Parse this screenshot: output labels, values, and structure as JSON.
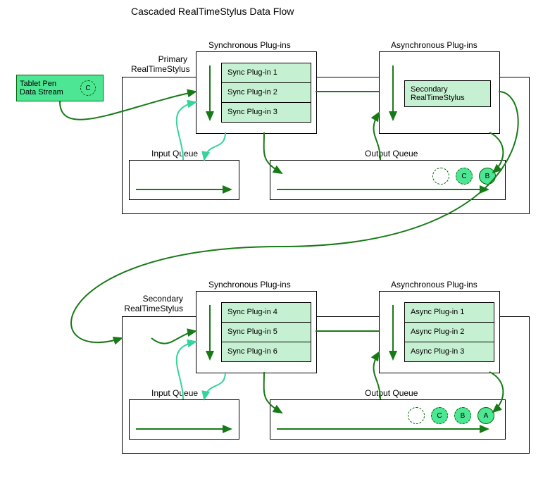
{
  "title": "Cascaded RealTimeStylus Data Flow",
  "tablet_pen": {
    "label": "Tablet Pen\nData Stream",
    "token": "C"
  },
  "primary": {
    "label": "Primary\nRealTimeStylus",
    "sync": {
      "heading": "Synchronous Plug-ins",
      "items": [
        "Sync Plug-in 1",
        "Sync Plug-in 2",
        "Sync Plug-in 3"
      ]
    },
    "async": {
      "heading": "Asynchronous Plug-ins",
      "secondary_label": "Secondary\nRealTimeStylus"
    },
    "input_queue": {
      "label": "Input Queue"
    },
    "output_queue": {
      "label": "Output Queue",
      "tokens": [
        {
          "letter": "",
          "style": "dashed"
        },
        {
          "letter": "C",
          "style": "dashed-fill"
        },
        {
          "letter": "B",
          "style": "solid-fill"
        }
      ]
    }
  },
  "secondary": {
    "label": "Secondary\nRealTimeStylus",
    "sync": {
      "heading": "Synchronous Plug-ins",
      "items": [
        "Sync Plug-in 4",
        "Sync Plug-in 5",
        "Sync Plug-in 6"
      ]
    },
    "async": {
      "heading": "Asynchronous Plug-ins",
      "items": [
        "Async Plug-in 1",
        "Async Plug-in 2",
        "Async Plug-in 3"
      ]
    },
    "input_queue": {
      "label": "Input Queue"
    },
    "output_queue": {
      "label": "Output Queue",
      "tokens": [
        {
          "letter": "",
          "style": "dashed"
        },
        {
          "letter": "C",
          "style": "dashed-fill"
        },
        {
          "letter": "B",
          "style": "dashed-fill"
        },
        {
          "letter": "A",
          "style": "solid-fill"
        }
      ]
    }
  },
  "colors": {
    "green_fill": "#c6f0d2",
    "green_strong": "#4de694",
    "arrow_dark": "#177a17",
    "arrow_light": "#35d49a"
  }
}
